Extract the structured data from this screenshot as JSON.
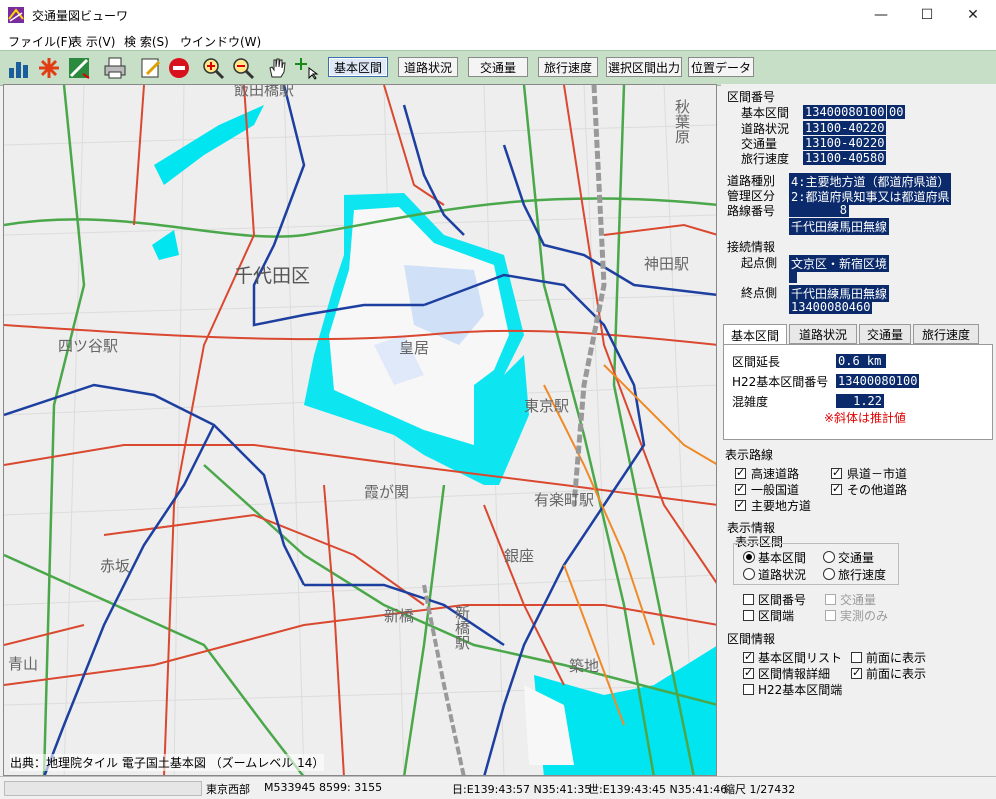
{
  "window": {
    "title": "交通量図ビューワ",
    "minimize": "—",
    "maximize": "☐",
    "close": "✕"
  },
  "menu": [
    "ファイル(F)",
    "表 示(V)",
    "検 索(S)",
    "ウインドウ(W)"
  ],
  "toolbar": {
    "buttons": [
      "基本区間",
      "道路状況",
      "交通量",
      "旅行速度",
      "選択区間出力",
      "位置データ"
    ],
    "active": "基本区間"
  },
  "map": {
    "labels": {
      "chiyoda": "千代田区",
      "kokyo": "皇居",
      "yotsuya": "四ツ谷駅",
      "akasaka": "赤坂",
      "shinbashi": "新橋",
      "shinbashi_eki": "新橋駅",
      "ginza": "銀座",
      "aoyama": "青山",
      "tokyo": "東京駅",
      "kanda": "神田駅",
      "yurakucho": "有楽町駅",
      "kasumigaseki": "霞が関",
      "tsukiji": "築地",
      "iidabashi": "飯田橋駅",
      "akihabara": "秋葉原"
    },
    "credit": "出典：地理院タイル 電子国土基本図 （ズームレベル 14）"
  },
  "panel": {
    "section_id_title": "区間番号",
    "section_ids": [
      {
        "label": "基本区間",
        "value": "13400080100",
        "extra": "00"
      },
      {
        "label": "道路状況",
        "value": "13100-40220"
      },
      {
        "label": "交通量",
        "value": "13100-40220"
      },
      {
        "label": "旅行速度",
        "value": "13100-40580"
      }
    ],
    "road_type_label": "道路種別",
    "road_type_value": "4:主要地方道（都道府県道）",
    "admin_label": "管理区分",
    "admin_value": "2:都道府県知事又は都道府県",
    "route_label": "路線番号",
    "route_value": "8",
    "route_name": "千代田練馬田無線",
    "connection_title": "接続情報",
    "start_label": "起点側",
    "start_value": "文京区・新宿区境",
    "start_value2": "",
    "end_label": "終点側",
    "end_value": "千代田練馬田無線",
    "end_value2": "13400080460",
    "tabs": [
      "基本区間",
      "道路状況",
      "交通量",
      "旅行速度"
    ],
    "tab_active": "基本区間",
    "length_label": "区間延長",
    "length_value": "0.6 km",
    "h22_label": "H22基本区間番号",
    "h22_value": "13400080100",
    "congestion_label": "混雑度",
    "congestion_value": "1.22",
    "italic_note": "※斜体は推計値",
    "display_routes_title": "表示路線",
    "routes": [
      {
        "label": "高速道路",
        "checked": true
      },
      {
        "label": "県道－市道",
        "checked": true
      },
      {
        "label": "一般国道",
        "checked": true
      },
      {
        "label": "その他道路",
        "checked": true
      },
      {
        "label": "主要地方道",
        "checked": true
      }
    ],
    "display_info_title": "表示情報",
    "display_section_title": "表示区間",
    "radios": [
      {
        "label": "基本区間",
        "checked": true
      },
      {
        "label": "交通量",
        "checked": false
      },
      {
        "label": "道路状況",
        "checked": false
      },
      {
        "label": "旅行速度",
        "checked": false
      }
    ],
    "display_checks": [
      {
        "label": "区間番号",
        "checked": false
      },
      {
        "label": "交通量",
        "checked": false,
        "disabled": true
      },
      {
        "label": "区間端",
        "checked": false
      },
      {
        "label": "実測のみ",
        "checked": false,
        "disabled": true
      }
    ],
    "section_info_title": "区間情報",
    "section_info_checks": [
      {
        "label": "基本区間リスト",
        "checked": true
      },
      {
        "label": "前面に表示",
        "checked": false
      },
      {
        "label": "区間情報詳細",
        "checked": true
      },
      {
        "label": "前面に表示",
        "checked": true
      },
      {
        "label": "H22基本区間端",
        "checked": false
      }
    ]
  },
  "status": {
    "area": "東京西部",
    "mesh": "M533945 8599: 3155",
    "japan": "日:E139:43:57 N35:41:35",
    "world": "世:E139:43:45 N35:41:46",
    "scale": "縮尺 1/27432"
  },
  "colors": {
    "toolbar_bg": "#c7dfc7",
    "highlight": "#0a2a6b",
    "palace_water": "#00e5f0",
    "road_red": "#d9482f",
    "road_green": "#4aa84a",
    "road_blue": "#1d3fa0",
    "road_orange": "#f08a28",
    "note_red": "#e00000"
  }
}
